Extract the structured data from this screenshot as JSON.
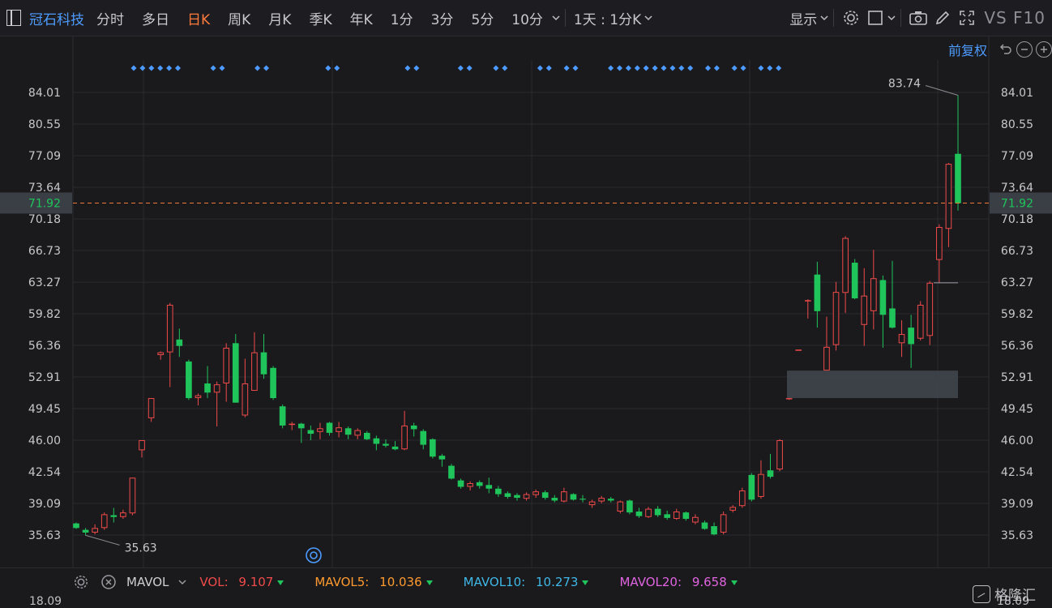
{
  "toolbar": {
    "stock_name": "冠石科技",
    "periods": [
      "分时",
      "多日",
      "日K",
      "周K",
      "月K",
      "季K",
      "年K",
      "1分",
      "3分",
      "5分",
      "10分"
    ],
    "active_period": "日K",
    "timeframe": "1天 : 1分K",
    "display": "显示",
    "vs_f10": "VS F10"
  },
  "adjust": {
    "label": "前复权"
  },
  "chart_data": {
    "type": "candlestick",
    "y_ticks": [
      "84.01",
      "80.55",
      "77.09",
      "73.64",
      "70.18",
      "66.73",
      "63.27",
      "59.82",
      "56.36",
      "52.91",
      "49.45",
      "46.00",
      "42.54",
      "39.09",
      "35.63"
    ],
    "ylim": [
      35.63,
      84.01
    ],
    "current_price": "71.92",
    "max_label": "83.74",
    "min_label": "35.63",
    "up_color": "#f04a4a",
    "down_color": "#1fc45b",
    "candles": [
      {
        "o": 36.9,
        "c": 36.4,
        "h": 37.0,
        "l": 36.3
      },
      {
        "o": 36.2,
        "c": 35.9,
        "h": 36.4,
        "l": 35.6
      },
      {
        "o": 35.9,
        "c": 36.4,
        "h": 36.8,
        "l": 35.7
      },
      {
        "o": 36.4,
        "c": 37.9,
        "h": 38.1,
        "l": 36.2
      },
      {
        "o": 37.8,
        "c": 37.6,
        "h": 38.6,
        "l": 37.0
      },
      {
        "o": 37.6,
        "c": 38.1,
        "h": 38.4,
        "l": 37.4
      },
      {
        "o": 38.0,
        "c": 41.9,
        "h": 41.9,
        "l": 37.8
      },
      {
        "o": 44.9,
        "c": 46.0,
        "h": 46.0,
        "l": 44.1
      },
      {
        "o": 48.4,
        "c": 50.6,
        "h": 50.6,
        "l": 48.0
      },
      {
        "o": 55.3,
        "c": 55.6,
        "h": 55.7,
        "l": 54.8
      },
      {
        "o": 55.6,
        "c": 60.8,
        "h": 61.0,
        "l": 51.8
      },
      {
        "o": 57.0,
        "c": 56.3,
        "h": 58.2,
        "l": 55.1
      },
      {
        "o": 54.6,
        "c": 50.6,
        "h": 54.8,
        "l": 50.4
      },
      {
        "o": 50.6,
        "c": 50.9,
        "h": 51.1,
        "l": 49.8
      },
      {
        "o": 52.2,
        "c": 51.2,
        "h": 54.1,
        "l": 50.6
      },
      {
        "o": 51.2,
        "c": 52.1,
        "h": 52.4,
        "l": 47.5
      },
      {
        "o": 52.2,
        "c": 56.1,
        "h": 56.6,
        "l": 50.2
      },
      {
        "o": 56.6,
        "c": 50.1,
        "h": 57.6,
        "l": 50.1
      },
      {
        "o": 48.7,
        "c": 52.2,
        "h": 54.9,
        "l": 48.5
      },
      {
        "o": 51.4,
        "c": 55.6,
        "h": 57.8,
        "l": 51.4
      },
      {
        "o": 55.6,
        "c": 53.2,
        "h": 57.6,
        "l": 52.7
      },
      {
        "o": 53.9,
        "c": 50.6,
        "h": 54.1,
        "l": 50.4
      },
      {
        "o": 49.7,
        "c": 47.6,
        "h": 49.9,
        "l": 47.3
      },
      {
        "o": 47.7,
        "c": 47.8,
        "h": 48.0,
        "l": 47.1
      },
      {
        "o": 47.8,
        "c": 47.3,
        "h": 47.9,
        "l": 45.7
      },
      {
        "o": 47.1,
        "c": 46.7,
        "h": 47.6,
        "l": 46.0
      },
      {
        "o": 46.9,
        "c": 47.3,
        "h": 47.9,
        "l": 46.1
      },
      {
        "o": 47.9,
        "c": 46.8,
        "h": 48.0,
        "l": 46.5
      },
      {
        "o": 46.9,
        "c": 47.4,
        "h": 48.0,
        "l": 46.3
      },
      {
        "o": 47.3,
        "c": 46.6,
        "h": 47.5,
        "l": 46.1
      },
      {
        "o": 46.5,
        "c": 47.1,
        "h": 47.3,
        "l": 46.1
      },
      {
        "o": 46.8,
        "c": 46.1,
        "h": 47.0,
        "l": 46.0
      },
      {
        "o": 46.2,
        "c": 45.6,
        "h": 46.5,
        "l": 44.9
      },
      {
        "o": 45.6,
        "c": 45.4,
        "h": 46.1,
        "l": 45.2
      },
      {
        "o": 45.3,
        "c": 45.0,
        "h": 45.9,
        "l": 44.9
      },
      {
        "o": 45.0,
        "c": 47.6,
        "h": 49.2,
        "l": 44.9
      },
      {
        "o": 47.6,
        "c": 47.2,
        "h": 47.9,
        "l": 46.4
      },
      {
        "o": 47.0,
        "c": 45.5,
        "h": 47.2,
        "l": 45.0
      },
      {
        "o": 46.1,
        "c": 44.2,
        "h": 46.2,
        "l": 44.0
      },
      {
        "o": 44.3,
        "c": 43.9,
        "h": 44.5,
        "l": 43.1
      },
      {
        "o": 43.2,
        "c": 41.8,
        "h": 43.4,
        "l": 41.7
      },
      {
        "o": 41.6,
        "c": 40.9,
        "h": 41.8,
        "l": 40.7
      },
      {
        "o": 40.9,
        "c": 41.3,
        "h": 41.5,
        "l": 40.5
      },
      {
        "o": 41.4,
        "c": 41.0,
        "h": 41.6,
        "l": 40.7
      },
      {
        "o": 41.1,
        "c": 40.7,
        "h": 41.9,
        "l": 40.2
      },
      {
        "o": 40.7,
        "c": 40.1,
        "h": 41.0,
        "l": 39.8
      },
      {
        "o": 40.2,
        "c": 39.8,
        "h": 40.4,
        "l": 39.6
      },
      {
        "o": 40.0,
        "c": 39.7,
        "h": 40.2,
        "l": 39.4
      },
      {
        "o": 39.6,
        "c": 40.1,
        "h": 40.3,
        "l": 39.4
      },
      {
        "o": 40.0,
        "c": 40.4,
        "h": 40.6,
        "l": 39.7
      },
      {
        "o": 40.3,
        "c": 39.7,
        "h": 40.5,
        "l": 39.5
      },
      {
        "o": 39.7,
        "c": 39.4,
        "h": 40.0,
        "l": 39.2
      },
      {
        "o": 39.3,
        "c": 40.4,
        "h": 40.8,
        "l": 39.2
      },
      {
        "o": 40.1,
        "c": 39.5,
        "h": 40.2,
        "l": 39.4
      },
      {
        "o": 39.6,
        "c": 39.5,
        "h": 40.0,
        "l": 39.2
      },
      {
        "o": 38.9,
        "c": 39.3,
        "h": 39.5,
        "l": 38.6
      },
      {
        "o": 39.3,
        "c": 39.7,
        "h": 39.9,
        "l": 39.1
      },
      {
        "o": 39.6,
        "c": 39.4,
        "h": 39.8,
        "l": 39.2
      },
      {
        "o": 38.2,
        "c": 39.3,
        "h": 39.4,
        "l": 38.0
      },
      {
        "o": 39.4,
        "c": 38.1,
        "h": 39.5,
        "l": 37.9
      },
      {
        "o": 38.2,
        "c": 37.7,
        "h": 38.6,
        "l": 37.5
      },
      {
        "o": 37.6,
        "c": 38.5,
        "h": 38.7,
        "l": 37.5
      },
      {
        "o": 38.5,
        "c": 37.8,
        "h": 38.8,
        "l": 37.6
      },
      {
        "o": 37.9,
        "c": 37.5,
        "h": 38.3,
        "l": 37.3
      },
      {
        "o": 37.4,
        "c": 38.2,
        "h": 38.5,
        "l": 37.3
      },
      {
        "o": 38.1,
        "c": 37.4,
        "h": 38.2,
        "l": 37.2
      },
      {
        "o": 37.0,
        "c": 37.6,
        "h": 37.9,
        "l": 36.8
      },
      {
        "o": 37.0,
        "c": 36.3,
        "h": 37.2,
        "l": 36.2
      },
      {
        "o": 36.6,
        "c": 35.7,
        "h": 37.0,
        "l": 35.6
      },
      {
        "o": 35.9,
        "c": 37.9,
        "h": 38.2,
        "l": 35.7
      },
      {
        "o": 38.3,
        "c": 38.7,
        "h": 38.9,
        "l": 38.1
      },
      {
        "o": 38.8,
        "c": 40.5,
        "h": 40.8,
        "l": 38.6
      },
      {
        "o": 42.2,
        "c": 39.5,
        "h": 42.4,
        "l": 39.3
      },
      {
        "o": 39.8,
        "c": 42.3,
        "h": 43.8,
        "l": 39.6
      },
      {
        "o": 42.7,
        "c": 42.0,
        "h": 44.5,
        "l": 41.8
      },
      {
        "o": 42.8,
        "c": 46.0,
        "h": 46.1,
        "l": 42.6
      },
      {
        "o": 50.5,
        "c": 50.6,
        "h": 50.6,
        "l": 50.4
      },
      {
        "o": 55.9,
        "c": 55.9,
        "h": 55.9,
        "l": 55.8
      },
      {
        "o": 61.2,
        "c": 61.3,
        "h": 61.4,
        "l": 59.3
      },
      {
        "o": 64.1,
        "c": 60.1,
        "h": 65.5,
        "l": 58.3
      },
      {
        "o": 53.6,
        "c": 56.2,
        "h": 59.5,
        "l": 53.5
      },
      {
        "o": 56.4,
        "c": 62.2,
        "h": 63.3,
        "l": 55.8
      },
      {
        "o": 62.1,
        "c": 68.1,
        "h": 68.3,
        "l": 59.9
      },
      {
        "o": 65.4,
        "c": 61.5,
        "h": 65.8,
        "l": 61.4
      },
      {
        "o": 58.6,
        "c": 61.8,
        "h": 64.8,
        "l": 56.3
      },
      {
        "o": 60.1,
        "c": 63.7,
        "h": 66.8,
        "l": 58.1
      },
      {
        "o": 63.5,
        "c": 59.7,
        "h": 64.0,
        "l": 56.1
      },
      {
        "o": 60.4,
        "c": 58.3,
        "h": 65.6,
        "l": 58.2
      },
      {
        "o": 56.6,
        "c": 57.6,
        "h": 59.1,
        "l": 55.1
      },
      {
        "o": 58.3,
        "c": 56.5,
        "h": 59.7,
        "l": 53.9
      },
      {
        "o": 57.1,
        "c": 60.8,
        "h": 61.2,
        "l": 56.9
      },
      {
        "o": 57.4,
        "c": 63.2,
        "h": 63.4,
        "l": 56.4
      },
      {
        "o": 65.7,
        "c": 69.3,
        "h": 69.6,
        "l": 63.2
      },
      {
        "o": 69.1,
        "c": 76.2,
        "h": 76.3,
        "l": 67.1
      },
      {
        "o": 77.3,
        "c": 71.9,
        "h": 83.7,
        "l": 71.1
      }
    ],
    "signal_dot_groups": [
      [
        0,
        5
      ],
      [
        9,
        10
      ],
      [
        14,
        15
      ],
      [
        22,
        23
      ],
      [
        31,
        32
      ],
      [
        37,
        38
      ],
      [
        41,
        42
      ],
      [
        46,
        47
      ],
      [
        49,
        50
      ],
      [
        54,
        63
      ],
      [
        65,
        66
      ],
      [
        68,
        69
      ],
      [
        71,
        73
      ]
    ]
  },
  "indicator": {
    "name": "MAVOL",
    "vol_label": "VOL:",
    "vol_value": "9.107",
    "mavol5_label": "MAVOL5:",
    "mavol5_value": "10.036",
    "mavol10_label": "MAVOL10:",
    "mavol10_value": "10.273",
    "mavol20_label": "MAVOL20:",
    "mavol20_value": "9.658",
    "vol_axis": "18.09",
    "colors": {
      "vol": "#f04a4a",
      "mavol5": "#ff9a2e",
      "mavol10": "#3fb8e8",
      "mavol20": "#e063e0"
    }
  },
  "watermark": {
    "text": "格隆汇"
  }
}
